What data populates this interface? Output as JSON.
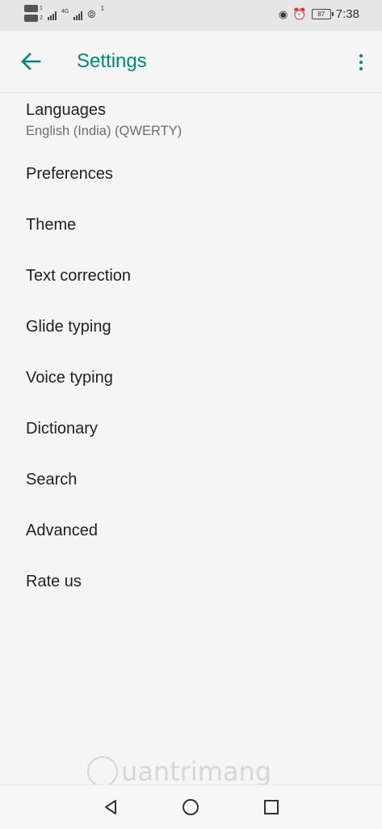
{
  "status_bar": {
    "sim1_label": "1",
    "sim2_label": "2",
    "network_type": "4G",
    "notification_count": "1",
    "battery": "87",
    "time": "7:38"
  },
  "toolbar": {
    "title": "Settings",
    "back_icon": "arrow-left-icon",
    "menu_icon": "more-vert-icon",
    "accent_color": "#00897b"
  },
  "settings": {
    "items": [
      {
        "label": "Languages",
        "sublabel": "English (India) (QWERTY)"
      },
      {
        "label": "Preferences"
      },
      {
        "label": "Theme"
      },
      {
        "label": "Text correction"
      },
      {
        "label": "Glide typing"
      },
      {
        "label": "Voice typing"
      },
      {
        "label": "Dictionary"
      },
      {
        "label": "Search"
      },
      {
        "label": "Advanced"
      },
      {
        "label": "Rate us"
      }
    ]
  },
  "watermark": {
    "text": "uantrimang"
  },
  "nav_bar": {
    "back_icon": "triangle-back-icon",
    "home_icon": "circle-home-icon",
    "recents_icon": "square-recents-icon"
  }
}
